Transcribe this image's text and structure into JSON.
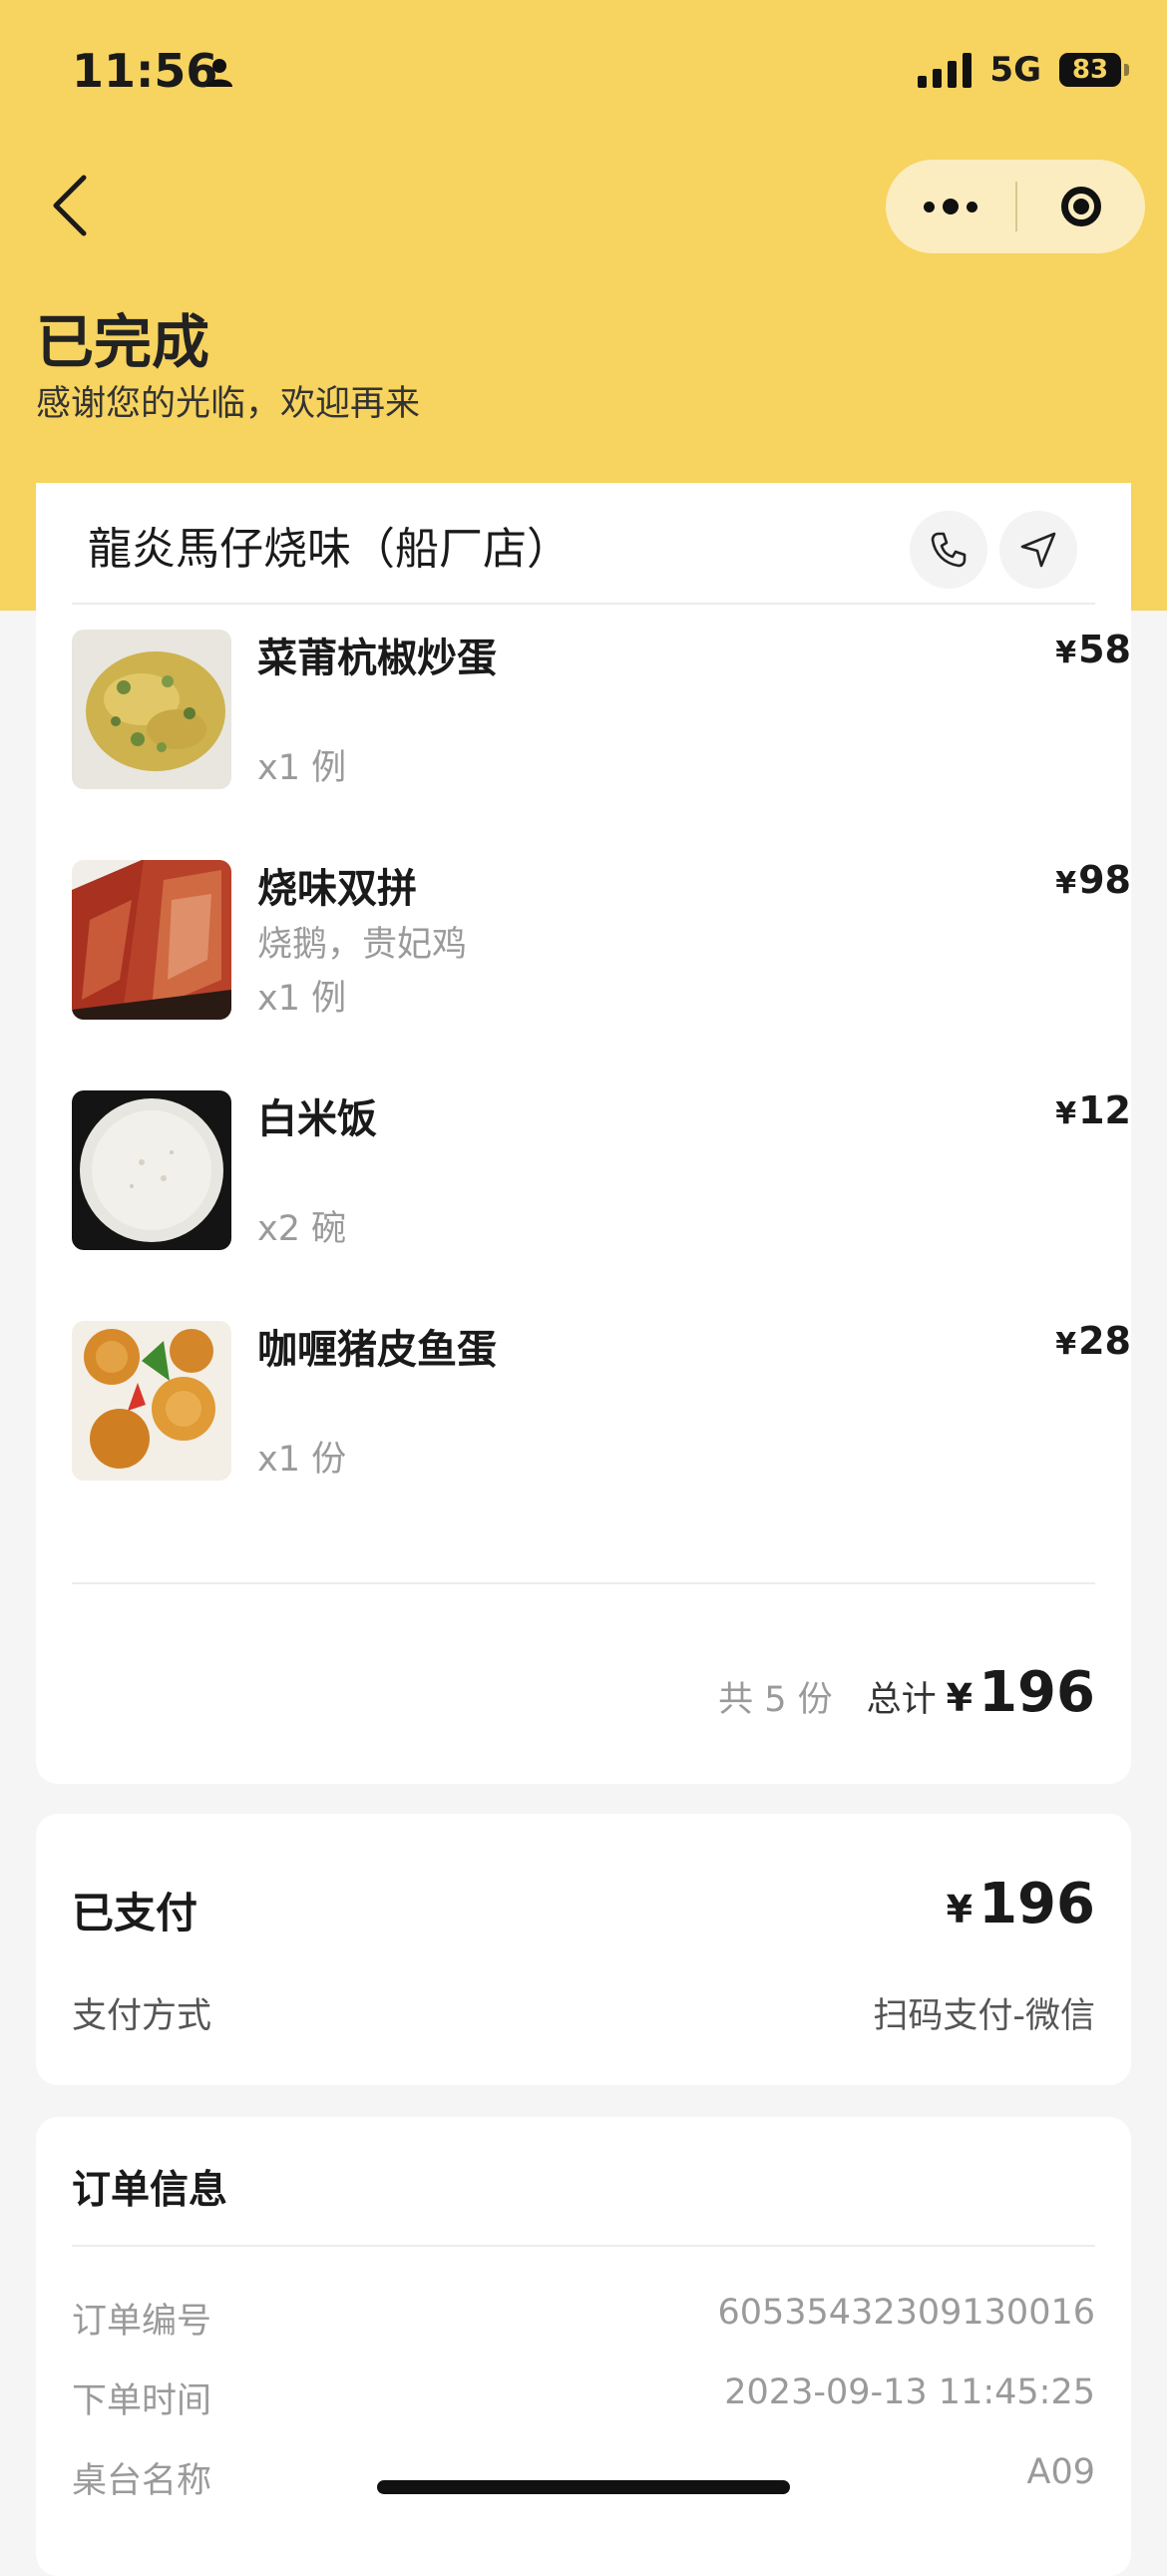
{
  "status_bar": {
    "time": "11:56",
    "network": "5G",
    "battery": "83"
  },
  "header": {
    "title": "已完成",
    "subtitle": "感谢您的光临，欢迎再来",
    "capsule_more_icon": "more-dots-icon",
    "capsule_close_icon": "target-close-icon"
  },
  "order": {
    "shop_name": "龍炎馬仔烧味（船厂店）",
    "items": [
      {
        "name": "菜莆杭椒炒蛋",
        "spec": "",
        "qty": "x1 例",
        "currency": "¥",
        "price": "58"
      },
      {
        "name": "烧味双拼",
        "spec": "烧鹅，贵妃鸡",
        "qty": "x1 例",
        "currency": "¥",
        "price": "98"
      },
      {
        "name": "白米饭",
        "spec": "",
        "qty": "x2 碗",
        "currency": "¥",
        "price": "12"
      },
      {
        "name": "咖喱猪皮鱼蛋",
        "spec": "",
        "qty": "x1 份",
        "currency": "¥",
        "price": "28"
      }
    ],
    "count_text": "共 5 份",
    "total_label": "总计",
    "total_currency": "¥",
    "total_amount": "196"
  },
  "payment": {
    "status": "已支付",
    "currency": "¥",
    "amount": "196",
    "method_label": "支付方式",
    "method_value": "扫码支付-微信"
  },
  "info": {
    "title": "订单信息",
    "rows": [
      {
        "label": "订单编号",
        "value": "60535432309130016"
      },
      {
        "label": "下单时间",
        "value": "2023-09-13 11:45:25"
      },
      {
        "label": "桌台名称",
        "value": "A09"
      }
    ]
  },
  "colors": {
    "header_bg": "#f7d35f",
    "page_bg": "#f5f5f5",
    "capsule_bg": "#fbedbf"
  }
}
